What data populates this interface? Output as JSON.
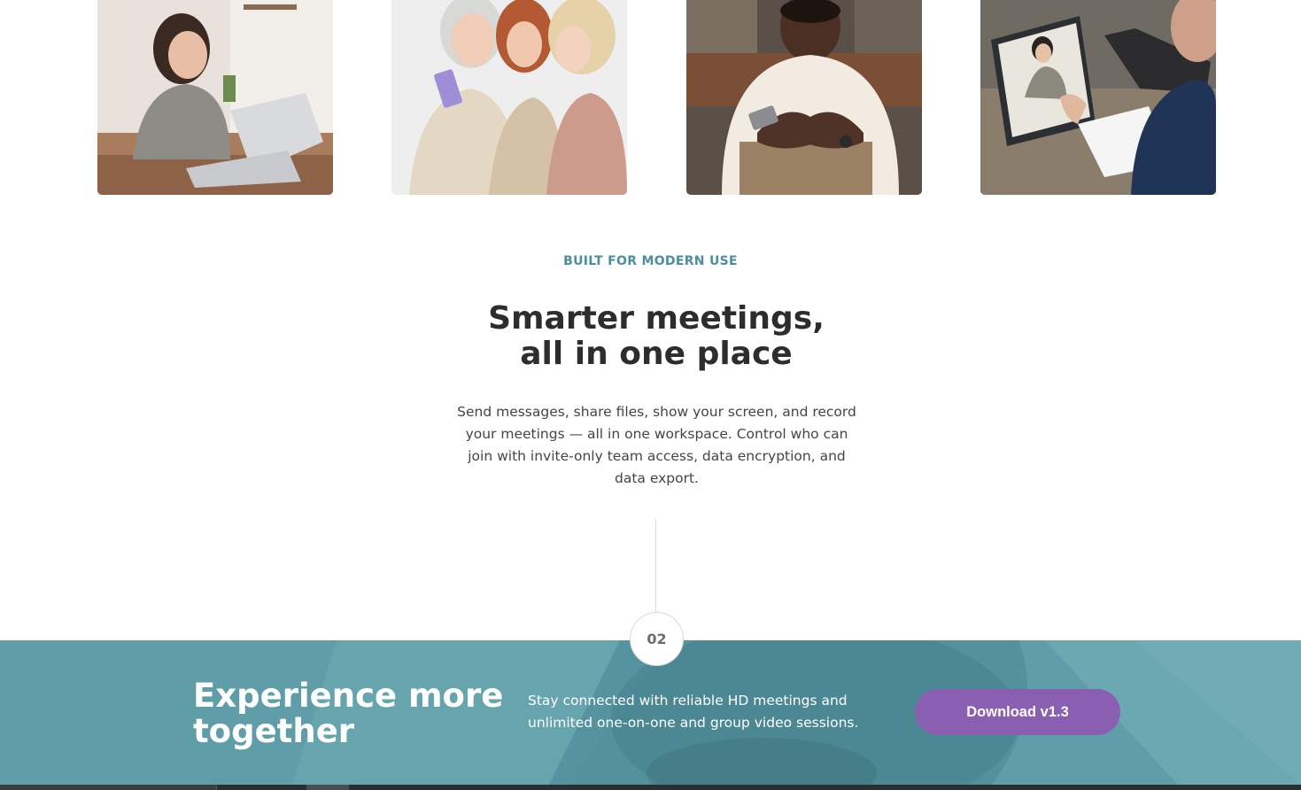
{
  "photos": [
    {
      "alt": "Woman smiling at laptop in kitchen"
    },
    {
      "alt": "Three women looking at a phone"
    },
    {
      "alt": "Man smiling while using a smartphone"
    },
    {
      "alt": "Person on a video call with a student"
    }
  ],
  "intro": {
    "eyebrow": "BUILT FOR MODERN USE",
    "headline_line1": "Smarter meetings,",
    "headline_line2": "all in one place",
    "body": "Send messages, share files, show your screen, and record your meetings — all in one workspace. Control who can join with invite-only team access, data encryption, and data export."
  },
  "step": {
    "number": "02"
  },
  "banner": {
    "title": "Experience more together",
    "text": "Stay connected with reliable HD meetings and unlimited one-on-one and group video sessions.",
    "button_label": "Download v1.3"
  },
  "colors": {
    "accent": "#4c8e9d",
    "banner_bg": "#5f9ea9",
    "button": "#8a5eb0",
    "heading": "#2d2d2d"
  }
}
